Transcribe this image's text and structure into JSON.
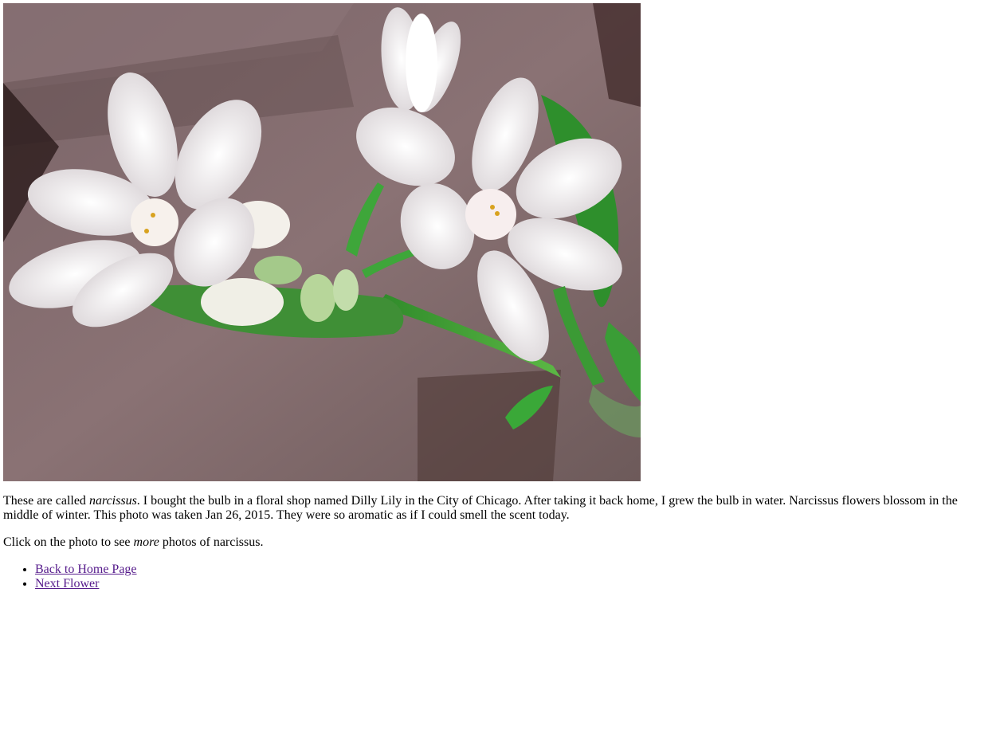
{
  "photo": {
    "alt": "narcissus",
    "subject": "white narcissus flowers"
  },
  "description": {
    "part1": "These are called ",
    "emphasis": "narcissus",
    "part2": ". I bought the bulb in a floral shop named Dilly Lily in the City of Chicago. After taking it back home, I grew the bulb in water. Narcissus flowers blossom in the middle of winter. This photo was taken Jan 26, 2015. They were so aromatic as if I could smell the scent today."
  },
  "instruction": {
    "part1": "Click on the photo to see ",
    "emphasis": "more",
    "part2": " photos of narcissus."
  },
  "nav": {
    "items": [
      {
        "label": "Back to Home Page"
      },
      {
        "label": "Next Flower"
      }
    ]
  },
  "colors": {
    "link_visited": "#551a8b",
    "text": "#000000",
    "background": "#ffffff"
  }
}
